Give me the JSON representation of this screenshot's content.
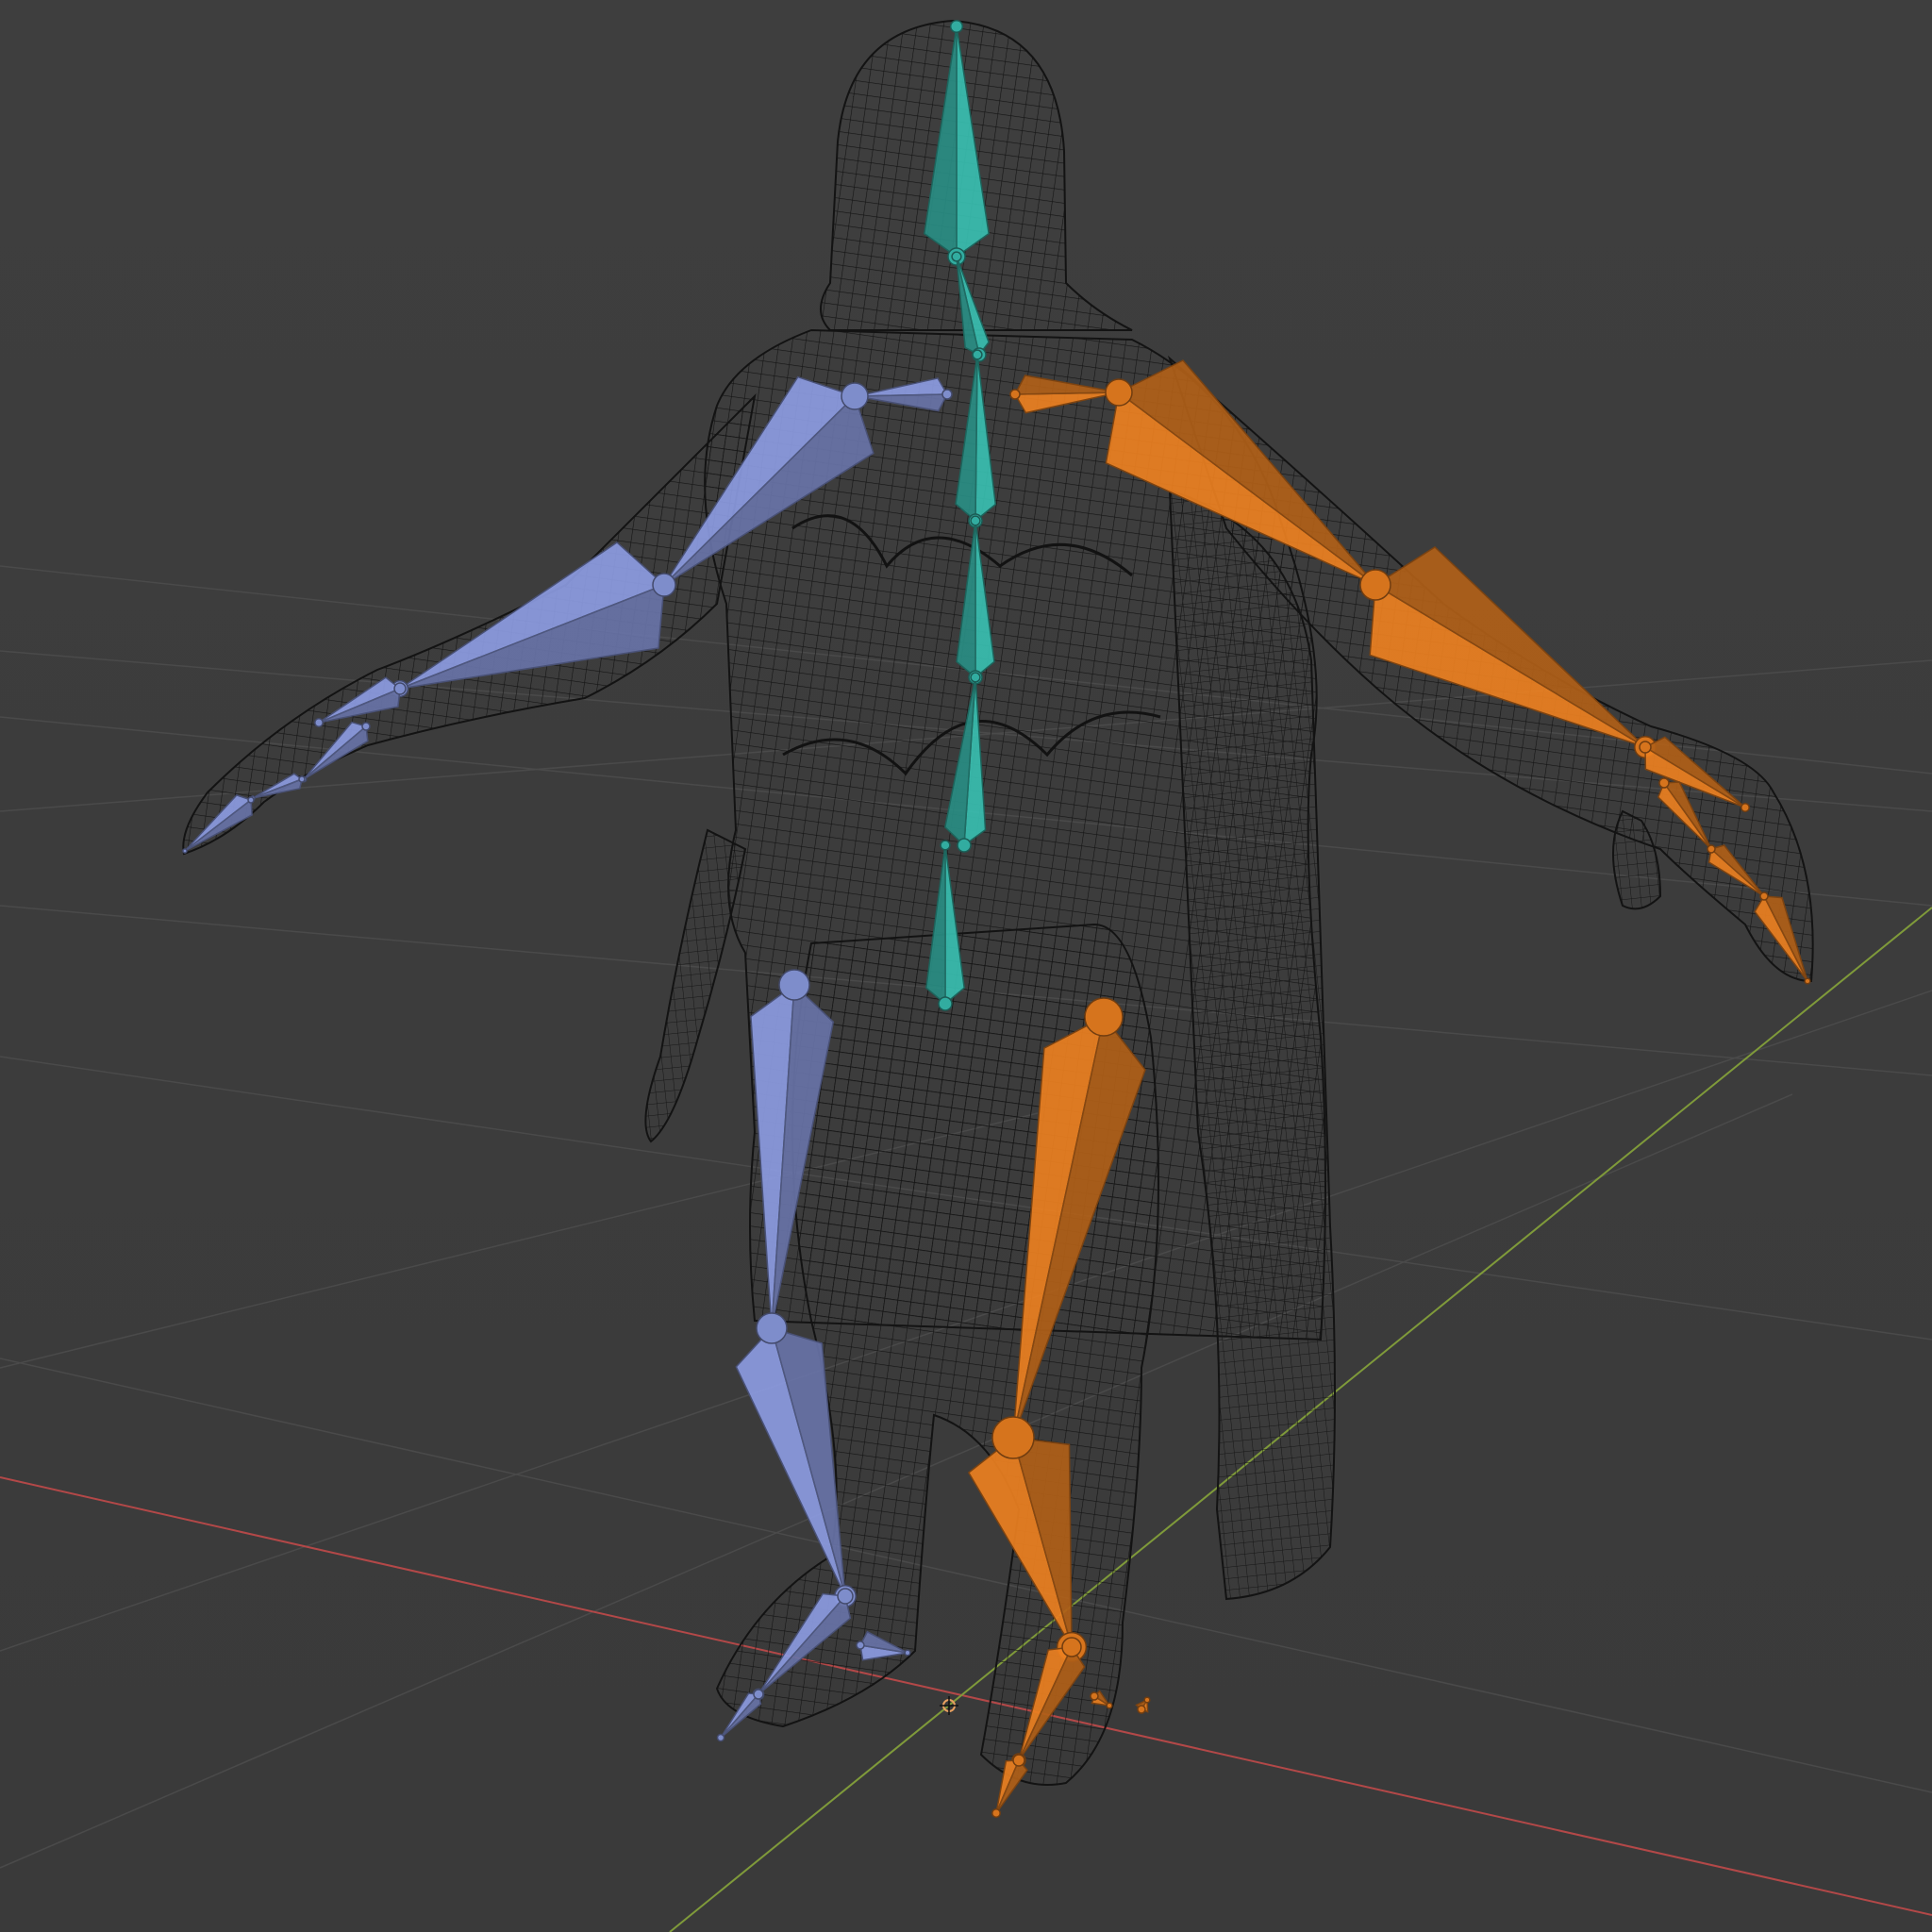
{
  "viewport": {
    "mode": "armature-over-wireframe",
    "background_color": "#3d3d3d"
  },
  "colors": {
    "grid_line": "#4a4a4a",
    "axis_x": "#b34848",
    "axis_y": "#7f9a3a",
    "wireframe": "#0f0f0f",
    "bone_center": "#35b5a8",
    "bone_left": "#8594d6",
    "bone_right": "#e17a1f"
  },
  "armature": {
    "bone_groups": [
      {
        "name": "center",
        "color_ref": "bone_center"
      },
      {
        "name": "left",
        "color_ref": "bone_left"
      },
      {
        "name": "right",
        "color_ref": "bone_right"
      }
    ]
  },
  "icons": {
    "origin": "object-origin-icon",
    "wireframe_mesh": "character-mesh"
  }
}
